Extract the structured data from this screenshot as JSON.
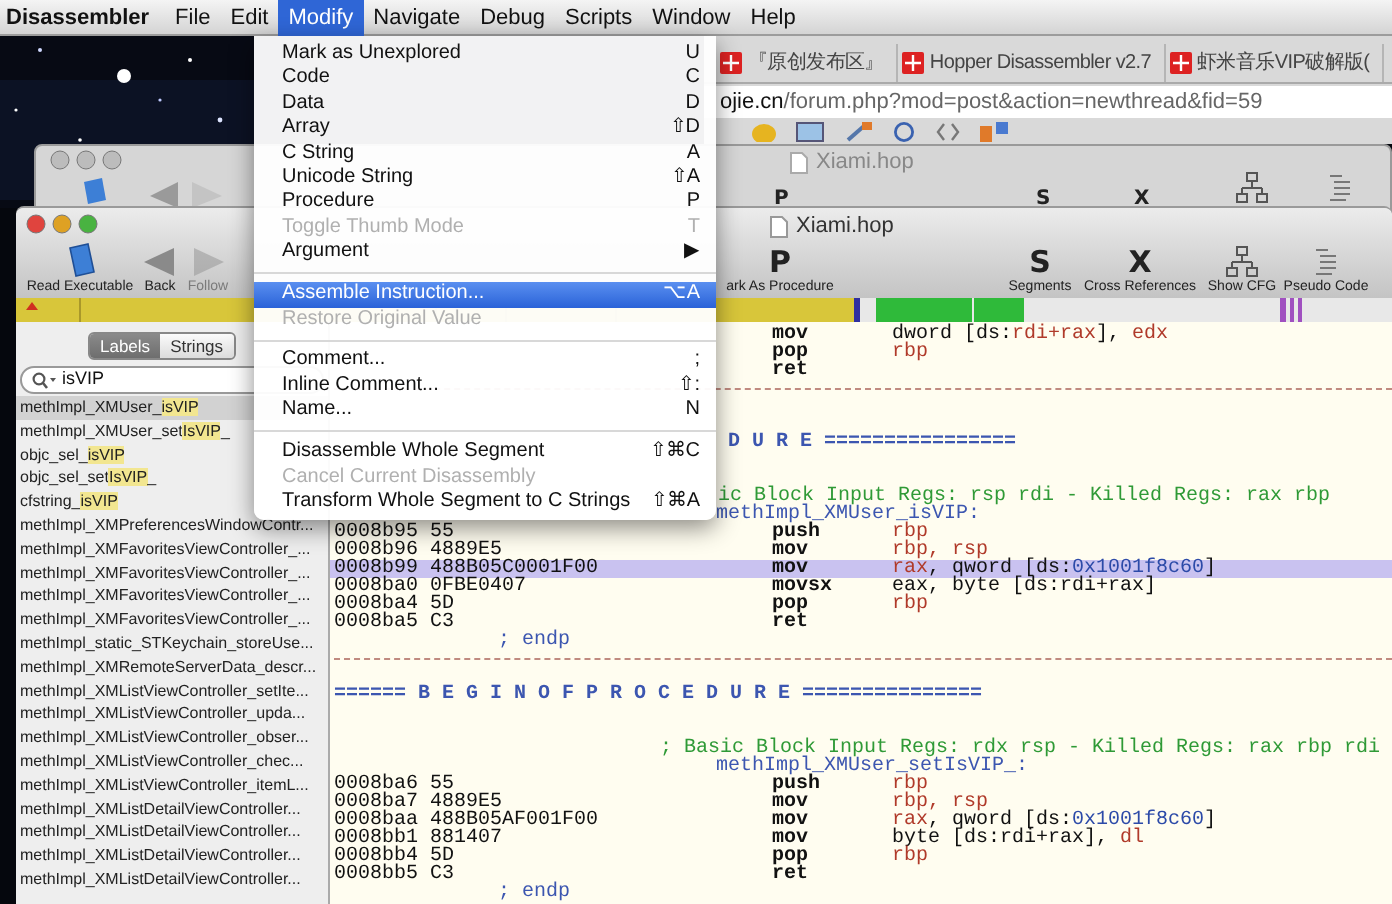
{
  "menu_bar": [
    {
      "label": "Disassembler",
      "kind": "app",
      "selected": false
    },
    {
      "label": "File",
      "kind": "menu",
      "selected": false
    },
    {
      "label": "Edit",
      "kind": "menu",
      "selected": false
    },
    {
      "label": "Modify",
      "kind": "menu",
      "selected": true
    },
    {
      "label": "Navigate",
      "kind": "menu",
      "selected": false
    },
    {
      "label": "Debug",
      "kind": "menu",
      "selected": false
    },
    {
      "label": "Scripts",
      "kind": "menu",
      "selected": false
    },
    {
      "label": "Window",
      "kind": "menu",
      "selected": false
    },
    {
      "label": "Help",
      "kind": "menu",
      "selected": false
    }
  ],
  "browser": {
    "tabs": [
      {
        "label": "『原创发布区』"
      },
      {
        "label": "Hopper Disassembler v2.7"
      },
      {
        "label": "虾米音乐VIP破解版("
      }
    ],
    "url": "**ojie.cn**/forum.php?mod=post&action=newthread&fid=59"
  },
  "back_window": {
    "title": "Xiami.hop",
    "toolbar": [
      {
        "kind": "glyph",
        "glyph": "P"
      },
      {
        "kind": "glyph",
        "glyph": "S"
      },
      {
        "kind": "glyph",
        "glyph": "X"
      },
      {
        "kind": "cfg"
      },
      {
        "kind": "pseudo"
      }
    ]
  },
  "window": {
    "title": "Xiami.hop",
    "toolbar": [
      {
        "kind": "document",
        "label": "Read Executable",
        "disabled": false
      },
      {
        "kind": "back",
        "label": "Back",
        "disabled": false
      },
      {
        "kind": "forward",
        "label": "Follow",
        "disabled": true
      },
      {
        "kind": "glyph",
        "glyph": "P",
        "label": "ark As Procedure",
        "disabled": false
      },
      {
        "kind": "glyph",
        "glyph": "S",
        "label": "Segments",
        "disabled": false
      },
      {
        "kind": "glyph",
        "glyph": "X",
        "label": "Cross References",
        "disabled": false
      },
      {
        "kind": "cfg",
        "label": "Show CFG",
        "disabled": false
      },
      {
        "kind": "pseudo",
        "label": "Pseudo Code",
        "disabled": false
      }
    ],
    "sidebar": {
      "segments": [
        {
          "label": "Labels",
          "selected": true
        },
        {
          "label": "Strings",
          "selected": false
        }
      ],
      "search": {
        "value": "isVIP"
      },
      "items": [
        {
          "label": "methImpl_XMUser_**isVIP**",
          "selected": true
        },
        {
          "label": "methImpl_XMUser_set**IsVIP**_",
          "selected": false
        },
        {
          "label": "objc_sel_**isVIP**",
          "selected": false
        },
        {
          "label": "objc_sel_set**IsVIP**_",
          "selected": false
        },
        {
          "label": "cfstring_**isVIP**",
          "selected": false
        },
        {
          "label": "methImpl_XMPreferencesWindowContr...",
          "selected": false
        },
        {
          "label": "methImpl_XMFavoritesViewController_...",
          "selected": false
        },
        {
          "label": "methImpl_XMFavoritesViewController_...",
          "selected": false
        },
        {
          "label": "methImpl_XMFavoritesViewController_...",
          "selected": false
        },
        {
          "label": "methImpl_XMFavoritesViewController_...",
          "selected": false
        },
        {
          "label": "methImpl_static_STKeychain_storeUse...",
          "selected": false
        },
        {
          "label": "methImpl_XMRemoteServerData_descr...",
          "selected": false
        },
        {
          "label": "methImpl_XMListViewController_setIte...",
          "selected": false
        },
        {
          "label": "methImpl_XMListViewController_upda...",
          "selected": false
        },
        {
          "label": "methImpl_XMListViewController_obser...",
          "selected": false
        },
        {
          "label": "methImpl_XMListViewController_chec...",
          "selected": false
        },
        {
          "label": "methImpl_XMListViewController_itemL...",
          "selected": false
        },
        {
          "label": "methImpl_XMListDetailViewController...",
          "selected": false
        },
        {
          "label": "methImpl_XMListDetailViewController...",
          "selected": false
        },
        {
          "label": "methImpl_XMListDetailViewController...",
          "selected": false
        },
        {
          "label": "methImpl_XMListDetailViewController...",
          "selected": false
        }
      ]
    },
    "code": {
      "lines": [
        {
          "kind": "instr",
          "selected": false,
          "mnemonic": "mov",
          "operands": [
            {
              "text": "dword [ds:",
              "kind": "plain"
            },
            {
              "text": "rdi+rax",
              "kind": "reg"
            },
            {
              "text": "], ",
              "kind": "plain"
            },
            {
              "text": "edx",
              "kind": "reg"
            }
          ]
        },
        {
          "kind": "instr",
          "selected": false,
          "mnemonic": "pop",
          "operands": [
            {
              "text": "rbp",
              "kind": "reg"
            }
          ]
        },
        {
          "kind": "instr",
          "selected": false,
          "mnemonic": "ret"
        },
        {
          "kind": "separator"
        },
        {
          "kind": "blank"
        },
        {
          "kind": "blank"
        },
        {
          "kind": "banner",
          "partial": true,
          "text": "D U R E ================"
        },
        {
          "kind": "blank"
        },
        {
          "kind": "blank"
        },
        {
          "kind": "comment",
          "partial": true,
          "text": "ic Block Input Regs: rsp rdi -  Killed Regs: rax rbp"
        },
        {
          "kind": "label",
          "text": "methImpl_XMUser_isVIP:"
        },
        {
          "kind": "instr",
          "selected": false,
          "address": "0008b95 55",
          "mnemonic": "push",
          "operands": [
            {
              "text": "rbp",
              "kind": "reg"
            }
          ]
        },
        {
          "kind": "instr",
          "selected": false,
          "address": "0008b96 4889E5",
          "mnemonic": "mov",
          "operands": [
            {
              "text": "rbp, rsp",
              "kind": "reg"
            }
          ]
        },
        {
          "kind": "instr",
          "selected": true,
          "address": "0008b99 488B05C0001F00",
          "mnemonic": "mov",
          "operands": [
            {
              "text": "rax",
              "kind": "reg"
            },
            {
              "text": ", qword [ds:",
              "kind": "plain"
            },
            {
              "text": "0x1001f8c60",
              "kind": "num"
            },
            {
              "text": "]",
              "kind": "plain"
            }
          ]
        },
        {
          "kind": "instr",
          "selected": false,
          "address": "0008ba0 0FBE0407",
          "mnemonic": "movsx",
          "operands": [
            {
              "text": "eax, byte [ds:rdi+rax]",
              "kind": "plain"
            }
          ]
        },
        {
          "kind": "instr",
          "selected": false,
          "address": "0008ba4 5D",
          "mnemonic": "pop",
          "operands": [
            {
              "text": "rbp",
              "kind": "reg"
            }
          ]
        },
        {
          "kind": "instr",
          "selected": false,
          "address": "0008ba5 C3",
          "mnemonic": "ret"
        },
        {
          "kind": "endp",
          "text": "; endp"
        },
        {
          "kind": "separator"
        },
        {
          "kind": "blank"
        },
        {
          "kind": "banner",
          "partial": false,
          "text": "====== B E G I N   O F   P R O C E D U R E ==============="
        },
        {
          "kind": "blank"
        },
        {
          "kind": "blank"
        },
        {
          "kind": "comment",
          "partial": false,
          "text": "; Basic Block Input Regs: rdx rsp -  Killed Regs: rax rbp rdi"
        },
        {
          "kind": "label",
          "text": "methImpl_XMUser_setIsVIP_:"
        },
        {
          "kind": "instr",
          "selected": false,
          "address": "0008ba6 55",
          "mnemonic": "push",
          "operands": [
            {
              "text": "rbp",
              "kind": "reg"
            }
          ]
        },
        {
          "kind": "instr",
          "selected": false,
          "address": "0008ba7 4889E5",
          "mnemonic": "mov",
          "operands": [
            {
              "text": "rbp, rsp",
              "kind": "reg"
            }
          ]
        },
        {
          "kind": "instr",
          "selected": false,
          "address": "0008baa 488B05AF001F00",
          "mnemonic": "mov",
          "operands": [
            {
              "text": "rax",
              "kind": "reg"
            },
            {
              "text": ", qword [ds:",
              "kind": "plain"
            },
            {
              "text": "0x1001f8c60",
              "kind": "num"
            },
            {
              "text": "]",
              "kind": "plain"
            }
          ]
        },
        {
          "kind": "instr",
          "selected": false,
          "address": "0008bb1 881407",
          "mnemonic": "mov",
          "operands": [
            {
              "text": "byte [ds:rdi+rax], ",
              "kind": "plain"
            },
            {
              "text": "dl",
              "kind": "reg"
            }
          ]
        },
        {
          "kind": "instr",
          "selected": false,
          "address": "0008bb4 5D",
          "mnemonic": "pop",
          "operands": [
            {
              "text": "rbp",
              "kind": "reg"
            }
          ]
        },
        {
          "kind": "instr",
          "selected": false,
          "address": "0008bb5 C3",
          "mnemonic": "ret"
        },
        {
          "kind": "endp",
          "text": "; endp"
        }
      ]
    }
  },
  "modify_menu": {
    "items": [
      {
        "kind": "item",
        "label": "Mark as Unexplored",
        "shortcut": "U",
        "disabled": false,
        "selected": false
      },
      {
        "kind": "item",
        "label": "Code",
        "shortcut": "C",
        "disabled": false,
        "selected": false
      },
      {
        "kind": "item",
        "label": "Data",
        "shortcut": "D",
        "disabled": false,
        "selected": false
      },
      {
        "kind": "item",
        "label": "Array",
        "shortcut": "⇧D",
        "disabled": false,
        "selected": false
      },
      {
        "kind": "item",
        "label": "C String",
        "shortcut": "A",
        "disabled": false,
        "selected": false
      },
      {
        "kind": "item",
        "label": "Unicode String",
        "shortcut": "⇧A",
        "disabled": false,
        "selected": false
      },
      {
        "kind": "item",
        "label": "Procedure",
        "shortcut": "P",
        "disabled": false,
        "selected": false
      },
      {
        "kind": "item",
        "label": "Toggle Thumb Mode",
        "shortcut": "T",
        "disabled": true,
        "selected": false
      },
      {
        "kind": "item",
        "label": "Argument",
        "shortcut": "▶",
        "disabled": false,
        "selected": false
      },
      {
        "kind": "separator"
      },
      {
        "kind": "item",
        "label": "Assemble Instruction...",
        "shortcut": "⌥A",
        "disabled": false,
        "selected": true
      },
      {
        "kind": "item",
        "label": "Restore Original Value",
        "disabled": true,
        "selected": false
      },
      {
        "kind": "separator"
      },
      {
        "kind": "item",
        "label": "Comment...",
        "shortcut": ";",
        "disabled": false,
        "selected": false
      },
      {
        "kind": "item",
        "label": "Inline Comment...",
        "shortcut": "⇧:",
        "disabled": false,
        "selected": false
      },
      {
        "kind": "item",
        "label": "Name...",
        "shortcut": "N",
        "disabled": false,
        "selected": false
      },
      {
        "kind": "separator"
      },
      {
        "kind": "item",
        "label": "Disassemble Whole Segment",
        "shortcut": "⇧⌘C",
        "disabled": false,
        "selected": false
      },
      {
        "kind": "item",
        "label": "Cancel Current Disassembly",
        "disabled": true,
        "selected": false
      },
      {
        "kind": "item",
        "label": "Transform Whole Segment to C Strings",
        "shortcut": "⇧⌘A",
        "disabled": false,
        "selected": false
      }
    ]
  }
}
